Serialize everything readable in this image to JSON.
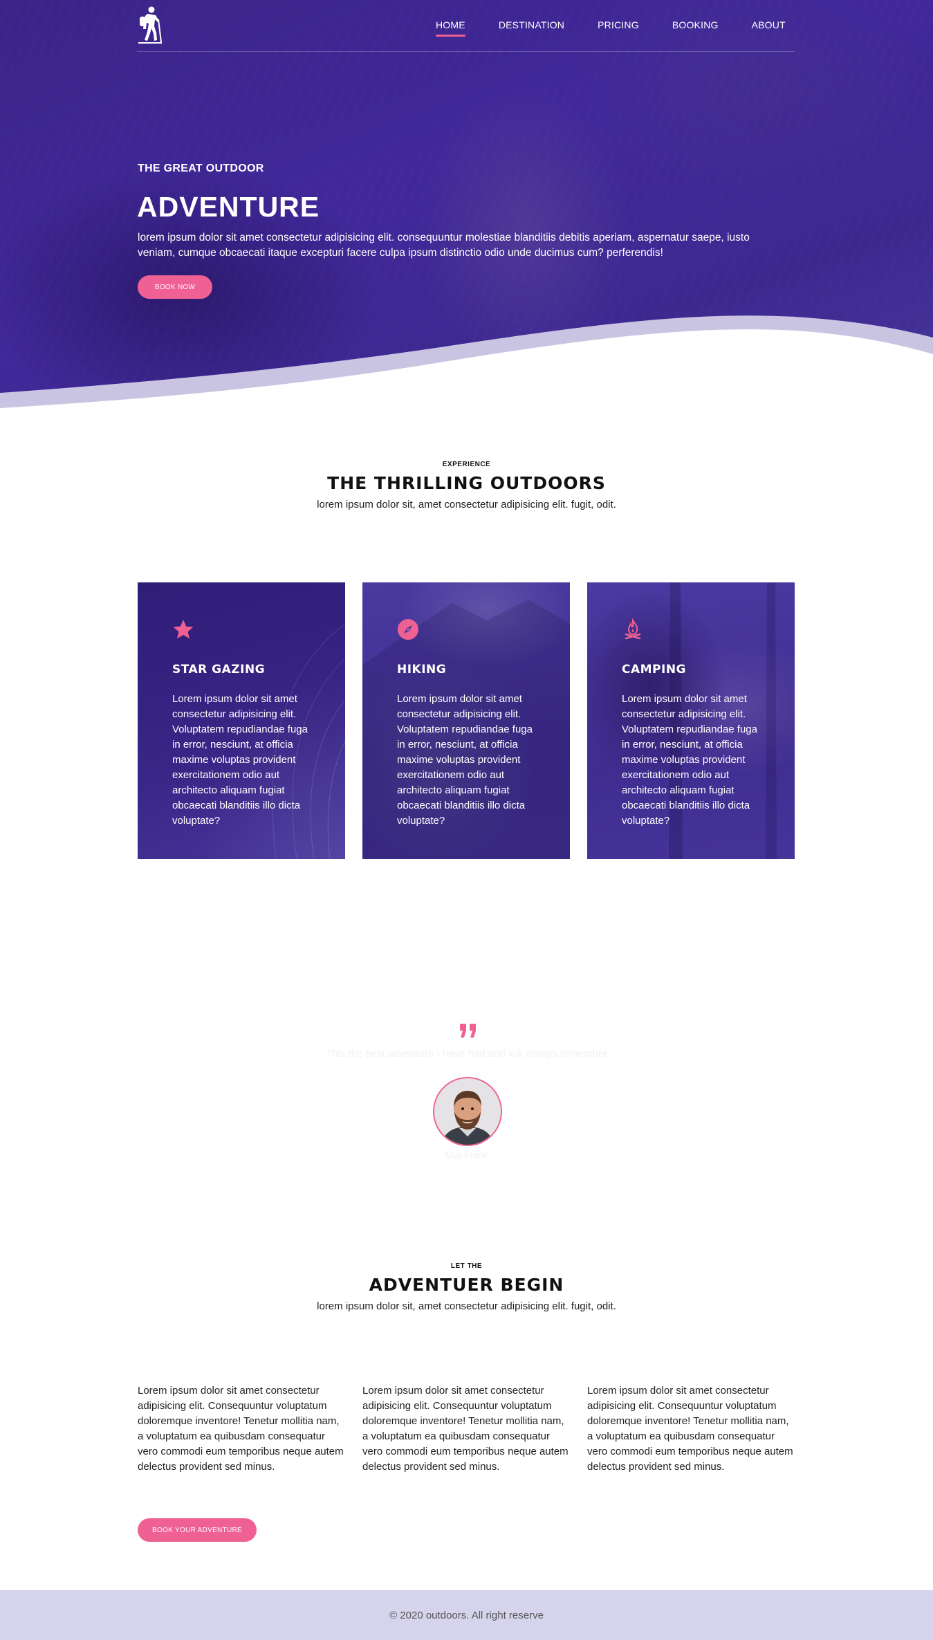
{
  "nav": {
    "items": [
      {
        "label": "HOME"
      },
      {
        "label": "DESTINATION"
      },
      {
        "label": "PRICING"
      },
      {
        "label": "BOOKING"
      },
      {
        "label": "ABOUT"
      }
    ],
    "active_index": 0
  },
  "hero": {
    "subtitle": "THE GREAT OUTDOOR",
    "title": "ADVENTURE",
    "text": "lorem ipsum dolor sit amet consectetur adipisicing elit. consequuntur molestiae blanditiis debitis aperiam, aspernatur saepe, iusto veniam, cumque obcaecati itaque excepturi facere culpa ipsum distinctio odio unde ducimus cum? perferendis!",
    "button": "BOOK NOW"
  },
  "experience": {
    "eyebrow": "EXPERIENCE",
    "title": "THE THRILLING OUTDOORS",
    "subtitle": "lorem ipsum dolor sit, amet consectetur adipisicing elit. fugit, odit."
  },
  "cards": [
    {
      "icon": "star-icon",
      "title": "STAR GAZING",
      "text": "Lorem ipsum dolor sit amet consectetur adipisicing elit. Voluptatem repudiandae fuga in error, nesciunt, at officia maxime voluptas provident exercitationem odio aut architecto aliquam fugiat obcaecati blanditiis illo dicta voluptate?"
    },
    {
      "icon": "compass-icon",
      "title": "HIKING",
      "text": "Lorem ipsum dolor sit amet consectetur adipisicing elit. Voluptatem repudiandae fuga in error, nesciunt, at officia maxime voluptas provident exercitationem odio aut architecto aliquam fugiat obcaecati blanditiis illo dicta voluptate?"
    },
    {
      "icon": "campfire-icon",
      "title": "CAMPING",
      "text": "Lorem ipsum dolor sit amet consectetur adipisicing elit. Voluptatem repudiandae fuga in error, nesciunt, at officia maxime voluptas provident exercitationem odio aut architecto aliquam fugiat obcaecati blanditiis illo dicta voluptate?"
    }
  ],
  "testimonial": {
    "quote": "This the best adventure I have had and will always remember",
    "author": "Guy Frank"
  },
  "begin": {
    "eyebrow": "LET THE",
    "title": "ADVENTUER BEGIN",
    "subtitle": "lorem ipsum dolor sit, amet consectetur adipisicing elit. fugit, odit.",
    "columns": [
      "Lorem ipsum dolor sit amet consectetur adipisicing elit. Consequuntur voluptatum doloremque inventore! Tenetur mollitia nam, a voluptatum ea quibusdam consequatur vero commodi eum temporibus neque autem delectus provident sed minus.",
      "Lorem ipsum dolor sit amet consectetur adipisicing elit. Consequuntur voluptatum doloremque inventore! Tenetur mollitia nam, a voluptatum ea quibusdam consequatur vero commodi eum temporibus neque autem delectus provident sed minus.",
      "Lorem ipsum dolor sit amet consectetur adipisicing elit. Consequuntur voluptatum doloremque inventore! Tenetur mollitia nam, a voluptatum ea quibusdam consequatur vero commodi eum temporibus neque autem delectus provident sed minus."
    ],
    "button": "BOOK YOUR ADVENTURE"
  },
  "footer": {
    "text": "© 2020 outdoors. All right reserve"
  },
  "colors": {
    "primary": "#3d2890",
    "accent": "#ef6093",
    "footer_bg": "#d6d4ec"
  }
}
